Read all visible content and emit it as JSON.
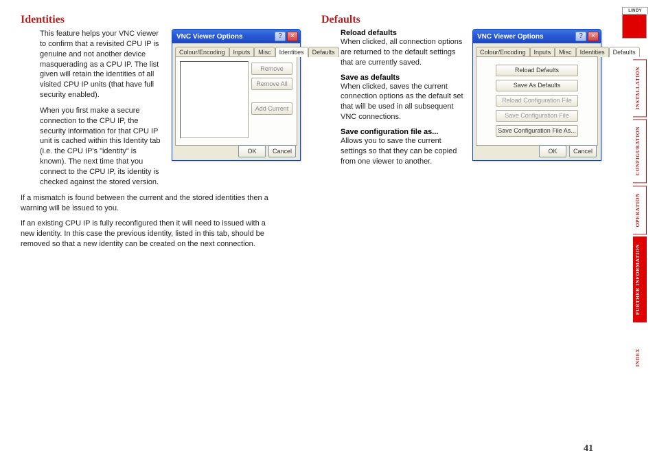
{
  "pageNumber": "41",
  "logoText": "LINDY",
  "identities": {
    "title": "Identities",
    "para1": "This feature helps your VNC viewer to confirm that a revisited CPU IP is genuine and not another device masquerading as a CPU IP. The list given will retain the identities of all visited CPU IP units (that have full security enabled).",
    "para2": "When you first make a secure connection to the CPU IP, the security information for that CPU IP unit is cached within this Identity tab (i.e. the CPU IP's \"identity\" is known). The next time that you connect to the CPU IP, its identity is checked against the stored version.",
    "para3": "If a mismatch is found between the current and the stored identities then a warning will be issued to you.",
    "para4": "If an existing CPU IP is fully reconfigured then it will need to issued with a new identity. In this case the previous identity, listed in this tab, should be removed so that a new identity can be created on the next connection.",
    "dialog": {
      "title": "VNC Viewer Options",
      "tabs": [
        "Colour/Encoding",
        "Inputs",
        "Misc",
        "Identities",
        "Defaults"
      ],
      "activeTab": 3,
      "buttons": {
        "remove": "Remove",
        "removeAll": "Remove All",
        "addCurrent": "Add Current"
      },
      "ok": "OK",
      "cancel": "Cancel"
    }
  },
  "defaults": {
    "title": "Defaults",
    "items": [
      {
        "h": "Reload defaults",
        "p": "When clicked, all connection options are returned to the default settings that are currently saved."
      },
      {
        "h": "Save as defaults",
        "p": "When clicked, saves the current connection options as the default set that will be used in all subsequent VNC connections."
      },
      {
        "h": "Save configuration file as...",
        "p": "Allows you to save the current settings so that they can be copied from one viewer to another."
      }
    ],
    "dialog": {
      "title": "VNC Viewer Options",
      "tabs": [
        "Colour/Encoding",
        "Inputs",
        "Misc",
        "Identities",
        "Defaults"
      ],
      "activeTab": 4,
      "buttons": [
        "Reload Defaults",
        "Save As Defaults",
        "Reload Configuration File",
        "Save Configuration File",
        "Save Configuration File As..."
      ],
      "disabled": [
        2,
        3
      ],
      "ok": "OK",
      "cancel": "Cancel"
    }
  },
  "nav": {
    "items": [
      "INSTALLATION",
      "CONFIGURATION",
      "OPERATION",
      "FURTHER\nINFORMATION",
      "INDEX"
    ],
    "activeIndex": 3
  }
}
